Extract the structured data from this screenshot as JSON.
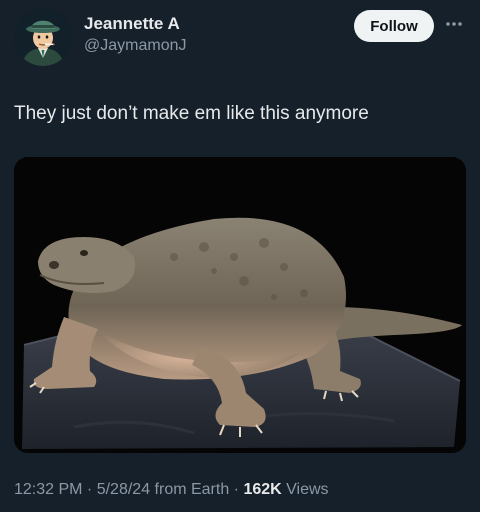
{
  "author": {
    "display_name": "Jeannette A",
    "handle": "@JaymamonJ",
    "avatar_icon": "cartoon-detective-avatar"
  },
  "actions": {
    "follow_label": "Follow",
    "more_icon": "more-dots-icon"
  },
  "tweet": {
    "text": "They just don’t make em like this anymore"
  },
  "media": {
    "image_subject": "prehistoric-reptile-model-photo"
  },
  "meta": {
    "time": "12:32 PM",
    "sep1": " · ",
    "date": "5/28/24",
    "source": " from Earth",
    "sep2": " · ",
    "views_count": "162K",
    "views_label": " Views"
  },
  "colors": {
    "background": "#15202b",
    "primary_text": "#e7e9ea",
    "secondary_text": "#8b98a5",
    "follow_button_bg": "#eff3f4"
  }
}
